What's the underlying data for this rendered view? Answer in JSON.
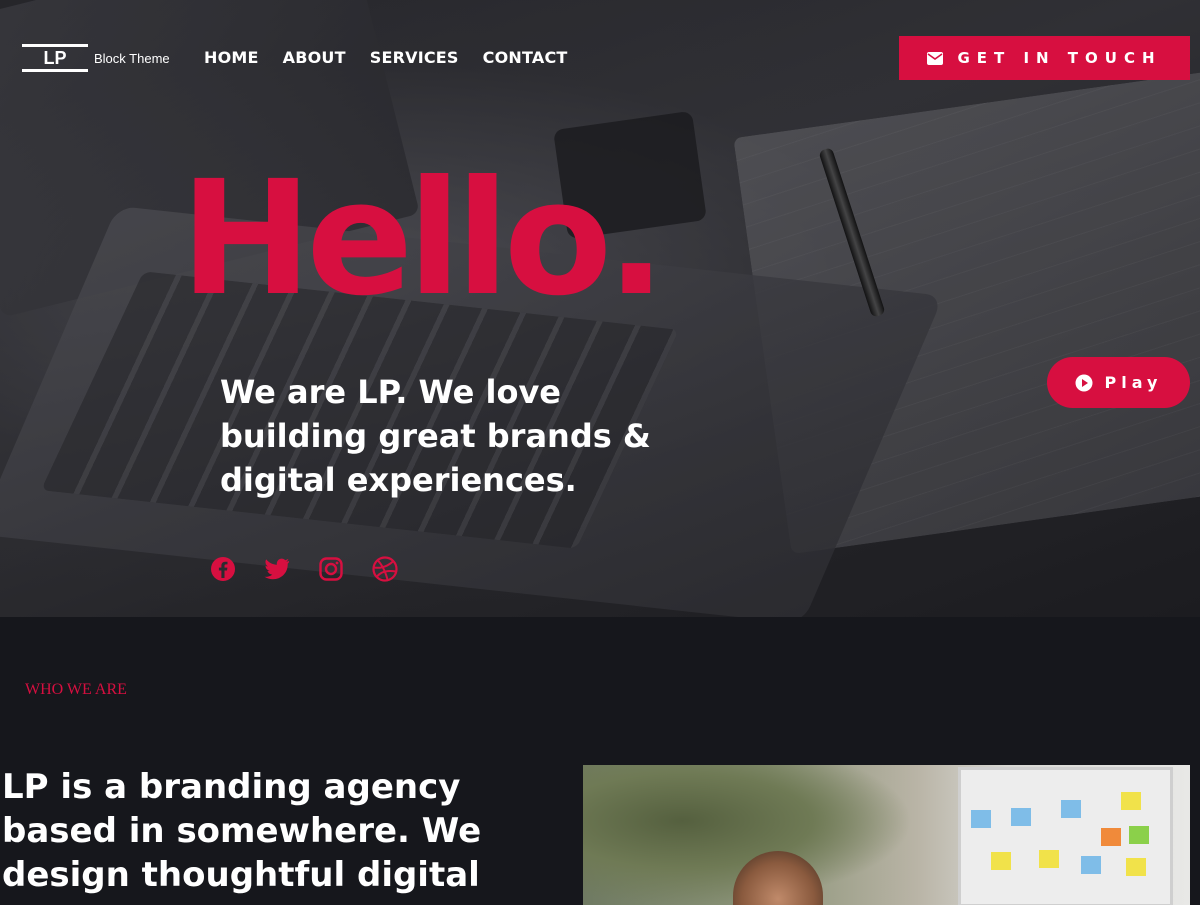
{
  "header": {
    "logo_mark": "LP",
    "logo_tagline": "Block Theme",
    "nav": [
      "HOME",
      "ABOUT",
      "SERVICES",
      "CONTACT"
    ],
    "cta_label": "GET IN TOUCH"
  },
  "hero": {
    "headline": "Hello.",
    "intro": "We are LP. We love building great brands & digital experiences.",
    "play_label": "Play",
    "socials": [
      "facebook-icon",
      "twitter-icon",
      "instagram-icon",
      "dribbble-icon"
    ]
  },
  "about": {
    "eyebrow": "WHO WE ARE",
    "text": "LP is a branding agency based in somewhere. We design thoughtful digital"
  },
  "colors": {
    "accent": "#d70f40",
    "background": "#16171c",
    "text": "#ffffff"
  }
}
